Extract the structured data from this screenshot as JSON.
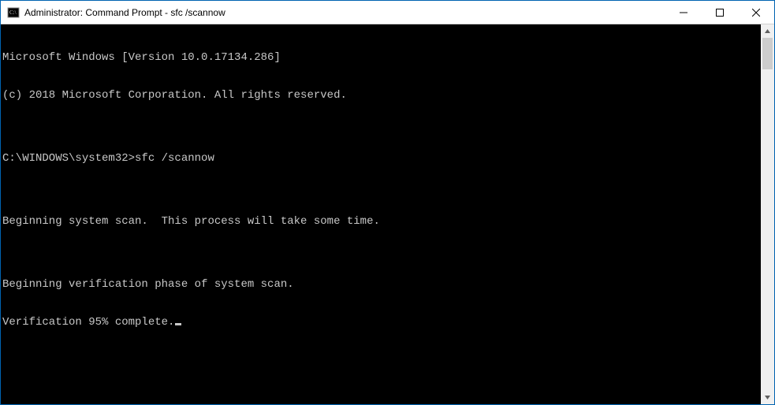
{
  "window": {
    "title": "Administrator: Command Prompt - sfc  /scannow"
  },
  "console": {
    "lines": [
      "Microsoft Windows [Version 10.0.17134.286]",
      "(c) 2018 Microsoft Corporation. All rights reserved.",
      "",
      "C:\\WINDOWS\\system32>sfc /scannow",
      "",
      "Beginning system scan.  This process will take some time.",
      "",
      "Beginning verification phase of system scan.",
      "Verification 95% complete."
    ]
  }
}
